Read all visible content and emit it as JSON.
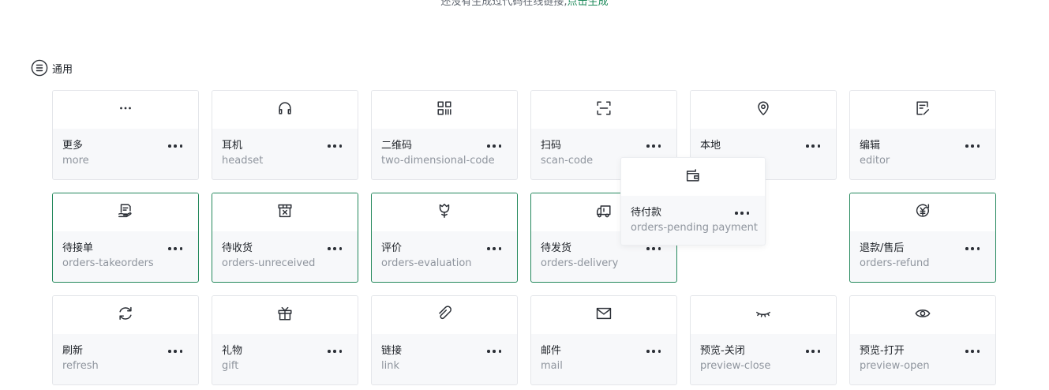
{
  "top_note": {
    "text": "还没有生成过代码在线链接,",
    "link": "点击生成"
  },
  "section": {
    "title": "通用",
    "icon": "list-circle-icon"
  },
  "colors": {
    "accent": "#24885c",
    "link": "#1f8a5b"
  },
  "icons": [
    {
      "name": "更多",
      "code": "more",
      "icon": "more-icon",
      "active": false
    },
    {
      "name": "耳机",
      "code": "headset",
      "icon": "headset-icon",
      "active": false
    },
    {
      "name": "二维码",
      "code": "two-dimensional-code",
      "icon": "qrcode-icon",
      "active": false
    },
    {
      "name": "扫码",
      "code": "scan-code",
      "icon": "scan-icon",
      "active": false
    },
    {
      "name": "本地",
      "code": "",
      "icon": "location-icon",
      "active": false
    },
    {
      "name": "编辑",
      "code": "editor",
      "icon": "editor-icon",
      "active": false
    },
    {
      "name": "待接单",
      "code": "orders-takeorders",
      "icon": "take-orders-icon",
      "active": true
    },
    {
      "name": "待收货",
      "code": "orders-unreceived",
      "icon": "unreceived-icon",
      "active": true
    },
    {
      "name": "评价",
      "code": "orders-evaluation",
      "icon": "evaluation-icon",
      "active": true
    },
    {
      "name": "待发货",
      "code": "orders-delivery",
      "icon": "delivery-truck-icon",
      "active": true
    },
    {
      "name": "退款/售后",
      "code": "orders-refund",
      "icon": "refund-icon",
      "active": true
    },
    {
      "name": "刷新",
      "code": "refresh",
      "icon": "refresh-icon",
      "active": false
    },
    {
      "name": "礼物",
      "code": "gift",
      "icon": "gift-icon",
      "active": false
    },
    {
      "name": "链接",
      "code": "link",
      "icon": "link-icon",
      "active": false
    },
    {
      "name": "邮件",
      "code": "mail",
      "icon": "mail-icon",
      "active": false
    },
    {
      "name": "预览-关闭",
      "code": "preview-close",
      "icon": "preview-close-icon",
      "active": false
    },
    {
      "name": "预览-打开",
      "code": "preview-open",
      "icon": "preview-open-icon",
      "active": false
    }
  ],
  "drag_popup": {
    "name": "待付款",
    "code": "orders-pending payment",
    "icon": "wallet-icon"
  }
}
